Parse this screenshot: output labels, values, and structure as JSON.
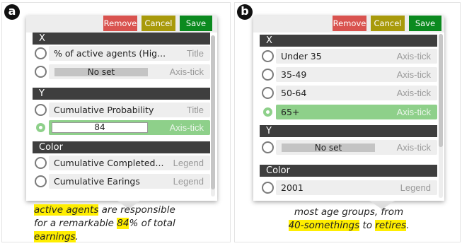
{
  "panel_a": {
    "badge": "a",
    "toolbar": {
      "remove": "Remove",
      "cancel": "Cancel",
      "save": "Save"
    },
    "sections": [
      {
        "title": "X",
        "rows": [
          {
            "label": "% of active agents (Hig...",
            "tag": "Title",
            "selected": false
          },
          {
            "label": "No set",
            "tag": "Axis-tick",
            "selected": false,
            "style": "bar"
          }
        ]
      },
      {
        "title": "Y",
        "rows": [
          {
            "label": "Cumulative Probability",
            "tag": "Title",
            "selected": false
          },
          {
            "label": "84",
            "tag": "Axis-tick",
            "selected": true,
            "style": "input"
          }
        ]
      },
      {
        "title": "Color",
        "rows": [
          {
            "label": "Cumulative Completed...",
            "tag": "Legend",
            "selected": false
          },
          {
            "label": "Cumulative Earings",
            "tag": "Legend",
            "selected": false
          }
        ]
      }
    ],
    "caption": {
      "line1": {
        "h1": "active agents",
        "t1": " are responsible"
      },
      "line2": {
        "t1": "for a remarkable ",
        "h1": "84",
        "t2": "% of total"
      },
      "line3": {
        "h1": "earnings",
        "t1": "."
      }
    }
  },
  "panel_b": {
    "badge": "b",
    "toolbar": {
      "remove": "Remove",
      "cancel": "Cancel",
      "save": "Save"
    },
    "sections": [
      {
        "title": "X",
        "rows": [
          {
            "label": "Under 35",
            "tag": "Axis-tick",
            "selected": false
          },
          {
            "label": "35-49",
            "tag": "Axis-tick",
            "selected": false
          },
          {
            "label": "50-64",
            "tag": "Axis-tick",
            "selected": false
          },
          {
            "label": "65+",
            "tag": "Axis-tick",
            "selected": true
          }
        ]
      },
      {
        "title": "Y",
        "rows": [
          {
            "label": "No set",
            "tag": "Axis-tick",
            "selected": false,
            "style": "bar"
          }
        ]
      },
      {
        "title": "Color",
        "rows": [
          {
            "label": "2001",
            "tag": "Legend",
            "selected": false
          }
        ]
      }
    ],
    "caption": {
      "line1": {
        "t1": "most  age  groups, from"
      },
      "line2": {
        "h1": "40-somethings",
        "t1": " to ",
        "h2": "retires",
        "t2": "."
      }
    }
  },
  "colors": {
    "remove": "#d9534f",
    "cancel": "#a89a0b",
    "save": "#0b8a1f",
    "section": "#3e3e3e",
    "selected": "#8ed08a",
    "highlight": "#ffee00"
  }
}
